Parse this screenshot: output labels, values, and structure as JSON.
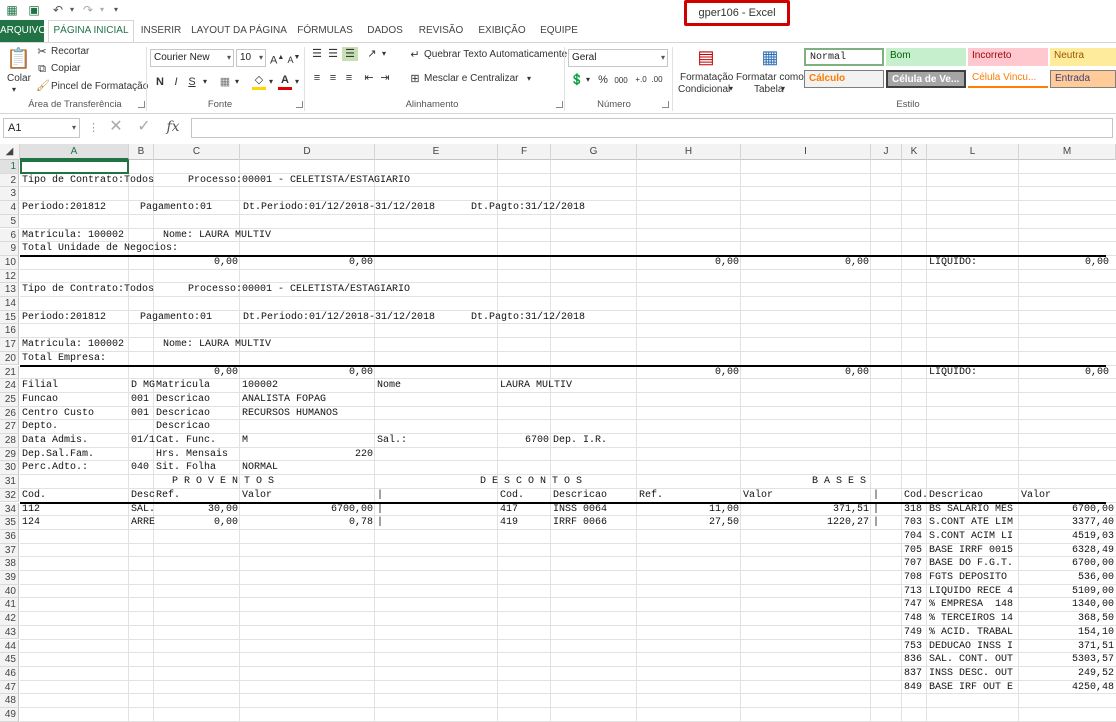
{
  "window": {
    "title": "gper106 - Excel"
  },
  "quick_access": {
    "save_icon": "save-icon",
    "undo_icon": "undo-icon",
    "redo_icon": "redo-icon",
    "customize_icon": "customize-icon"
  },
  "ribbon_tabs": [
    "ARQUIVO",
    "PÁGINA INICIAL",
    "INSERIR",
    "LAYOUT DA PÁGINA",
    "FÓRMULAS",
    "DADOS",
    "REVISÃO",
    "EXIBIÇÃO",
    "EQUIPE"
  ],
  "ribbon": {
    "clipboard": {
      "paste": "Colar",
      "cut": "Recortar",
      "copy": "Copiar",
      "format_painter": "Pincel de Formatação",
      "label": "Área de Transferência"
    },
    "font": {
      "name": "Courier New",
      "size": "10",
      "bold": "N",
      "italic": "I",
      "underline": "S",
      "label": "Fonte"
    },
    "alignment": {
      "wrap": "Quebrar Texto Automaticamente",
      "merge": "Mesclar e Centralizar",
      "label": "Alinhamento"
    },
    "number": {
      "format": "Geral",
      "percent": "%",
      "thousands": "000",
      "label": "Número"
    },
    "styles": {
      "conditional": [
        "Formatação",
        "Condicional"
      ],
      "as_table": [
        "Formatar como",
        "Tabela"
      ],
      "label": "Estilo",
      "cells": [
        "Normal",
        "Bom",
        "Incorreto",
        "Neutra",
        "Cálculo",
        "Célula de Ve...",
        "Célula Vincu...",
        "Entrada"
      ]
    }
  },
  "formula_bar": {
    "name_box": "A1",
    "fx": "fx",
    "formula": ""
  },
  "columns": [
    "A",
    "B",
    "C",
    "D",
    "E",
    "F",
    "G",
    "H",
    "I",
    "J",
    "K",
    "L",
    "M"
  ],
  "rows": [
    "1",
    "2",
    "3",
    "4",
    "5",
    "6",
    "9",
    "10",
    "12",
    "13",
    "14",
    "15",
    "16",
    "17",
    "20",
    "21",
    "24",
    "25",
    "26",
    "27",
    "28",
    "29",
    "30",
    "31",
    "32",
    "34",
    "35",
    "36",
    "37",
    "38",
    "39",
    "40",
    "41",
    "42",
    "43",
    "44",
    "45",
    "46",
    "47",
    "48",
    "49"
  ],
  "sheet": {
    "r2": [
      "Tipo de Contrato:Todos",
      "Processo:00001 - CELETISTA/ESTAGIARIO"
    ],
    "r4": [
      "Periodo:201812",
      "Pagamento:01",
      "Dt.Periodo:01/12/2018-31/12/2018",
      "Dt.Pagto:31/12/2018"
    ],
    "r6": [
      "Matricula: 100002",
      "Nome: LAURA MULTIV"
    ],
    "r9": "Total Unidade de Negocios:",
    "r10": [
      "0,00",
      "0,00",
      "0,00",
      "0,00",
      "LÍQUIDO:",
      "0,00"
    ],
    "r13": [
      "Tipo de Contrato:Todos",
      "Processo:00001 - CELETISTA/ESTAGIARIO"
    ],
    "r15": [
      "Periodo:201812",
      "Pagamento:01",
      "Dt.Periodo:01/12/2018-31/12/2018",
      "Dt.Pagto:31/12/2018"
    ],
    "r17": [
      "Matricula: 100002",
      "Nome: LAURA MULTIV"
    ],
    "r20": "Total Empresa:",
    "r21": [
      "0,00",
      "0,00",
      "0,00",
      "0,00",
      "LÍQUIDO:",
      "0,00"
    ],
    "r24": [
      "Filial",
      "D MG",
      "Matricula",
      "100002",
      "Nome",
      "LAURA MULTIV"
    ],
    "r25": [
      "Funcao",
      "001",
      "Descricao",
      "ANALISTA FOPAG"
    ],
    "r26": [
      "Centro Custo",
      "001",
      "Descricao",
      "RECURSOS HUMANOS"
    ],
    "r27": [
      "Depto.",
      "Descricao"
    ],
    "r28": [
      "Data Admis.",
      "01/1",
      "Cat. Func.",
      "M",
      "Sal.:",
      "6700",
      "Dep. I.R."
    ],
    "r29": [
      "Dep.Sal.Fam.",
      "Hrs. Mensais",
      "220"
    ],
    "r30": [
      "Perc.Adto.:",
      "040",
      "Sit. Folha",
      "NORMAL"
    ],
    "r31": [
      "P R O V E N T O S",
      "D E S C O N T O S",
      "B A S E S"
    ],
    "r32": [
      "Cod.",
      "Desc",
      "Ref.",
      "Valor",
      "|",
      "Cod.",
      "Descricao",
      "Ref.",
      "Valor",
      "|",
      "Cod.",
      "Descricao",
      "Valor"
    ],
    "r34": [
      "112",
      "SAL.",
      "30,00",
      "6700,00",
      "|",
      "417",
      "INSS 0064",
      "11,00",
      "371,51",
      "|",
      "318",
      "BS SALARIO MES",
      "6700,00"
    ],
    "r35": [
      "124",
      "ARRE",
      "0,00",
      "0,78",
      "|",
      "419",
      "IRRF 0066",
      "27,50",
      "1220,27",
      "|",
      "703",
      "S.CONT ATE LIM",
      "3377,40"
    ],
    "bases": [
      [
        "704",
        "S.CONT ACIM LI",
        "4519,03"
      ],
      [
        "705",
        "BASE IRRF 0015",
        "6328,49"
      ],
      [
        "707",
        "BASE DO F.G.T.",
        "6700,00"
      ],
      [
        "708",
        "FGTS DEPOSITO",
        "536,00"
      ],
      [
        "713",
        "LIQUIDO RECE 4",
        "5109,00"
      ],
      [
        "747",
        "% EMPRESA  148",
        "1340,00"
      ],
      [
        "748",
        "% TERCEIROS 14",
        "368,50"
      ],
      [
        "749",
        "% ACID. TRABAL",
        "154,10"
      ],
      [
        "753",
        "DEDUCAO INSS I",
        "371,51"
      ],
      [
        "836",
        "SAL. CONT. OUT",
        "5303,57"
      ],
      [
        "837",
        "INSS DESC. OUT",
        "249,52"
      ],
      [
        "849",
        "BASE IRF OUT E",
        "4250,48"
      ]
    ]
  }
}
